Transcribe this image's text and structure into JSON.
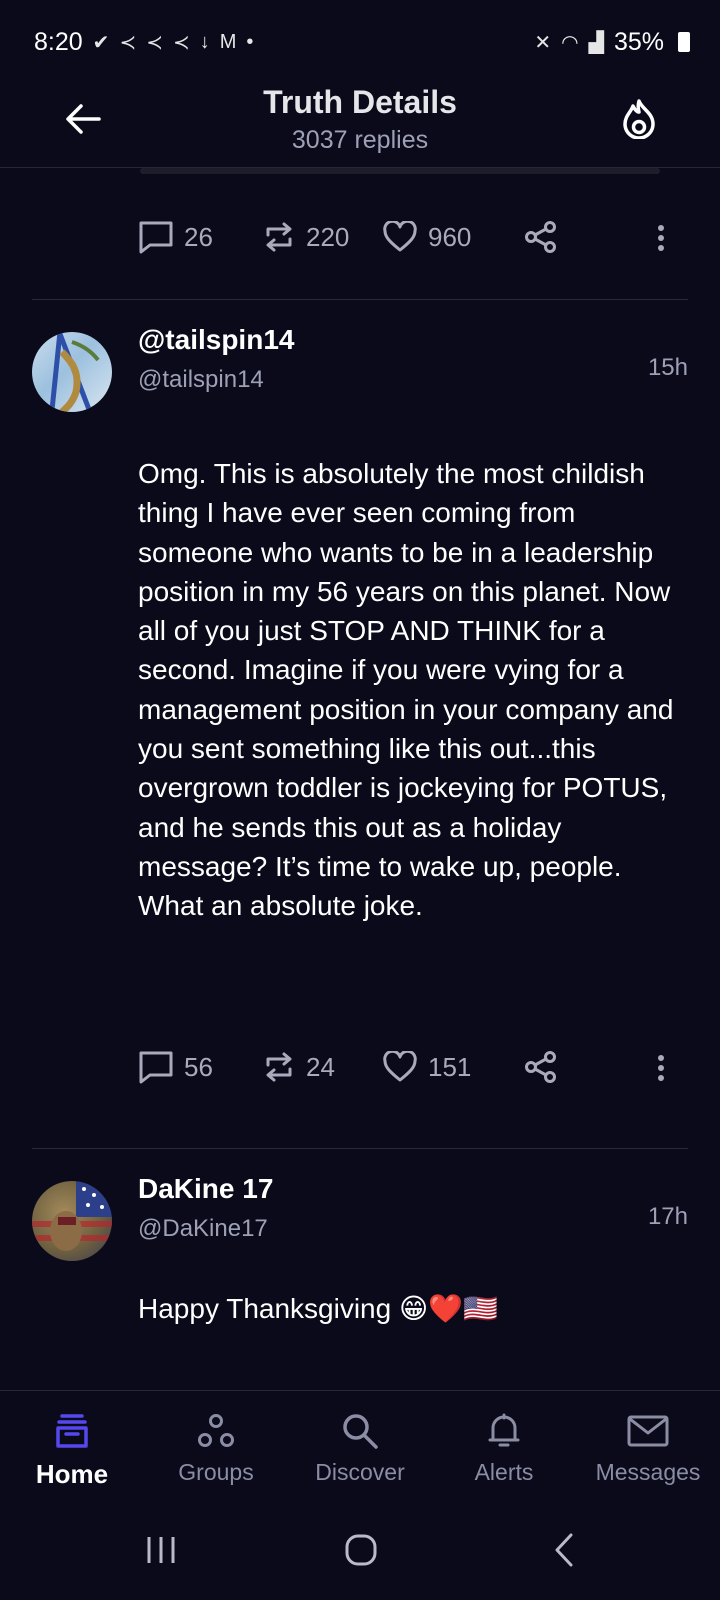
{
  "status_bar": {
    "time": "8:20",
    "left_icons": [
      "check-badge-icon",
      "bird-icon",
      "bird-icon",
      "bird-icon",
      "download-icon",
      "gmail-icon",
      "dot-icon"
    ],
    "right_icons": [
      "mute-icon",
      "wifi-icon",
      "signal-icon"
    ],
    "battery": "35%"
  },
  "header": {
    "title": "Truth Details",
    "subtitle": "3037 replies"
  },
  "top_actions": {
    "replies": "26",
    "retruths": "220",
    "likes": "960"
  },
  "posts": [
    {
      "name": "@tailspin14",
      "handle": "@tailspin14",
      "time": "15h",
      "body": "Omg. This is absolutely the most childish thing I have ever seen coming from someone who wants to be in a leadership position in my 56 years on this planet. Now all of you just STOP AND THINK for a second. Imagine if you were vying for a management position in your company and you sent something like this out...this overgrown toddler is jockeying for POTUS, and he sends this out as a holiday message? It’s time to wake up, people. What an absolute joke.",
      "replies": "56",
      "retruths": "24",
      "likes": "151"
    },
    {
      "name": "DaKine 17",
      "handle": "@DaKine17",
      "time": "17h",
      "body": "Happy Thanksgiving 😁❤️🇺🇸"
    }
  ],
  "bottom_nav": {
    "items": [
      {
        "label": "Home",
        "icon": "home-inbox-icon"
      },
      {
        "label": "Groups",
        "icon": "groups-icon"
      },
      {
        "label": "Discover",
        "icon": "search-icon"
      },
      {
        "label": "Alerts",
        "icon": "bell-icon"
      },
      {
        "label": "Messages",
        "icon": "mail-icon"
      }
    ],
    "active_color": "#5448ee"
  },
  "colors": {
    "background": "#0a0a1a",
    "muted": "#9ea1b5",
    "accent": "#5448ee"
  }
}
